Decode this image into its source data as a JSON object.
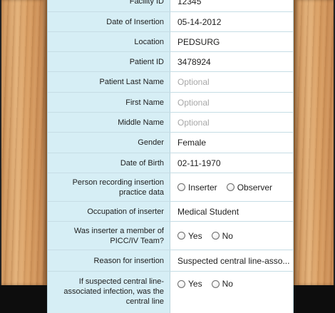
{
  "form": {
    "rows": [
      {
        "label": "Facility ID",
        "value": "12345"
      },
      {
        "label": "Date of Insertion",
        "value": "05-14-2012"
      },
      {
        "label": "Location",
        "value": "PEDSURG"
      },
      {
        "label": "Patient ID",
        "value": "3478924"
      },
      {
        "label": "Patient Last Name",
        "placeholder": "Optional"
      },
      {
        "label": "First Name",
        "placeholder": "Optional"
      },
      {
        "label": "Middle Name",
        "placeholder": "Optional"
      },
      {
        "label": "Gender",
        "value": "Female"
      },
      {
        "label": "Date of Birth",
        "value": "02-11-1970"
      },
      {
        "label": "Person recording insertion practice data",
        "options": [
          "Inserter",
          "Observer"
        ]
      },
      {
        "label": "Occupation of inserter",
        "value": "Medical Student"
      },
      {
        "label": "Was inserter a member of PICC/IV Team?",
        "options": [
          "Yes",
          "No"
        ]
      },
      {
        "label": "Reason for insertion",
        "value": "Suspected central line-asso..."
      },
      {
        "label": "If suspected central line-associated infection, was the central line",
        "options": [
          "Yes",
          "No"
        ]
      }
    ]
  }
}
